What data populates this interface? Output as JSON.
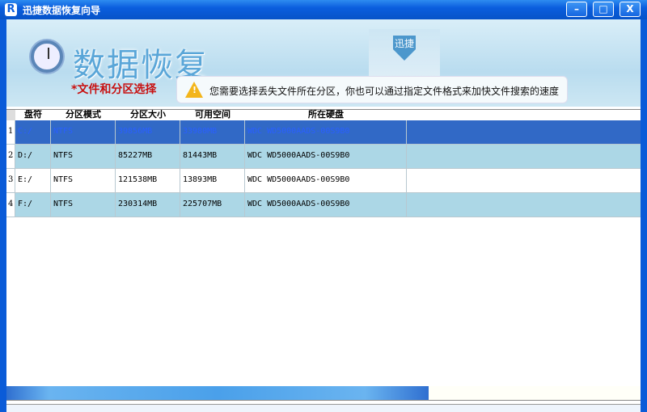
{
  "window": {
    "title": "迅捷数据恢复向导",
    "logo": "R",
    "minimize": "–",
    "maximize": "□",
    "close": "X"
  },
  "banner": {
    "title": "数据恢复",
    "badge": "迅捷",
    "step": "*文件和分区选择",
    "tip": "您需要选择丢失文件所在分区，你也可以通过指定文件格式来加快文件搜索的速度",
    "warn_icon": "!"
  },
  "table": {
    "columns": [
      "盘符",
      "分区模式",
      "分区大小",
      "可用空间",
      "所在硬盘"
    ],
    "rows": [
      {
        "n": "1",
        "drive": "C:/",
        "fs": "NTFS",
        "size": "39856MB",
        "free": "33980MB",
        "disk": "WDC WD5000AADS-00S9B0"
      },
      {
        "n": "2",
        "drive": "D:/",
        "fs": "NTFS",
        "size": "85227MB",
        "free": "81443MB",
        "disk": "WDC WD5000AADS-00S9B0"
      },
      {
        "n": "3",
        "drive": "E:/",
        "fs": "NTFS",
        "size": "121538MB",
        "free": "13893MB",
        "disk": "WDC WD5000AADS-00S9B0"
      },
      {
        "n": "4",
        "drive": "F:/",
        "fs": "NTFS",
        "size": "230314MB",
        "free": "225707MB",
        "disk": "WDC WD5000AADS-00S9B0"
      }
    ]
  }
}
